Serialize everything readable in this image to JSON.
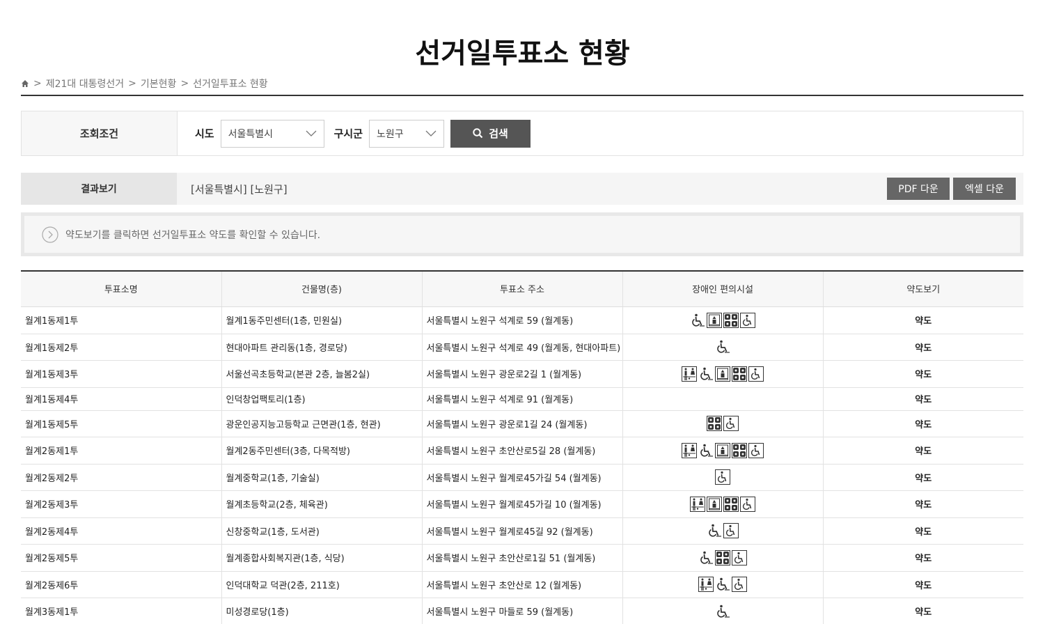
{
  "page": {
    "title": "선거일투표소 현황"
  },
  "breadcrumb": {
    "items": [
      "제21대 대통령선거",
      "기본현황",
      "선거일투표소 현황"
    ]
  },
  "search": {
    "label": "조회조건",
    "sido_label": "시도",
    "sido_value": "서울특별시",
    "gusigun_label": "구시군",
    "gusigun_value": "노원구",
    "button_label": "검색"
  },
  "result": {
    "label": "결과보기",
    "text": "[서울특별시] [노원구]",
    "pdf_label": "PDF 다운",
    "excel_label": "엑셀 다운"
  },
  "notice": {
    "text": "약도보기를 클릭하면 선거일투표소 약도를 확인할 수 있습니다."
  },
  "table": {
    "headers": [
      "투표소명",
      "건물명(층)",
      "투표소 주소",
      "장애인 편의시설",
      "약도보기"
    ],
    "rows": [
      {
        "name": "월계1동제1투",
        "building": "월계1동주민센터(1층, 민원실)",
        "address": "서울특별시 노원구 석계로 59 (월계동)",
        "icons": [
          "wheelchair-icon",
          "elevator-icon",
          "braille-icon",
          "accessible-toilet-icon"
        ],
        "map": "약도",
        "h": 39
      },
      {
        "name": "월계1동제2투",
        "building": "현대아파트 관리동(1층, 경로당)",
        "address": "서울특별시 노원구 석계로 49 (월계동, 현대아파트)",
        "icons": [
          "wheelchair-icon"
        ],
        "map": "약도",
        "h": 38
      },
      {
        "name": "월계1동제3투",
        "building": "서울선곡초등학교(본관 2층, 늘봄2실)",
        "address": "서울특별시 노원구 광운로2길 1 (월계동)",
        "icons": [
          "restroom-icon",
          "wheelchair-icon",
          "elevator-icon",
          "braille-icon",
          "accessible-toilet-icon"
        ],
        "map": "약도",
        "h": 39
      },
      {
        "name": "월계1동제4투",
        "building": "인덕창업팩토리(1층)",
        "address": "서울특별시 노원구 석계로 91 (월계동)",
        "icons": [],
        "map": "약도",
        "h": 33
      },
      {
        "name": "월계1동제5투",
        "building": "광운인공지능고등학교 근면관(1층, 현관)",
        "address": "서울특별시 노원구 광운로1길 24 (월계동)",
        "icons": [
          "braille-icon",
          "accessible-toilet-icon"
        ],
        "map": "약도",
        "h": 38
      },
      {
        "name": "월계2동제1투",
        "building": "월계2동주민센터(3층, 다목적방)",
        "address": "서울특별시 노원구 초안산로5길 28 (월계동)",
        "icons": [
          "restroom-icon",
          "wheelchair-icon",
          "elevator-icon",
          "braille-icon",
          "accessible-toilet-icon"
        ],
        "map": "약도",
        "h": 39
      },
      {
        "name": "월계2동제2투",
        "building": "월계중학교(1층, 기술실)",
        "address": "서울특별시 노원구 월계로45가길 54 (월계동)",
        "icons": [
          "accessible-toilet-icon"
        ],
        "map": "약도",
        "h": 38
      },
      {
        "name": "월계2동제3투",
        "building": "월계초등학교(2층, 체육관)",
        "address": "서울특별시 노원구 월계로45가길 10 (월계동)",
        "icons": [
          "restroom-icon",
          "elevator-icon",
          "braille-icon",
          "accessible-toilet-icon"
        ],
        "map": "약도",
        "h": 39
      },
      {
        "name": "월계2동제4투",
        "building": "신창중학교(1층, 도서관)",
        "address": "서울특별시 노원구 월계로45길 92 (월계동)",
        "icons": [
          "wheelchair-icon",
          "accessible-toilet-icon"
        ],
        "map": "약도",
        "h": 38
      },
      {
        "name": "월계2동제5투",
        "building": "월계종합사회복지관(1층, 식당)",
        "address": "서울특별시 노원구 초안산로1길 51 (월계동)",
        "icons": [
          "wheelchair-icon",
          "braille-icon",
          "accessible-toilet-icon"
        ],
        "map": "약도",
        "h": 39
      },
      {
        "name": "월계2동제6투",
        "building": "인덕대학교 덕관(2층, 211호)",
        "address": "서울특별시 노원구 초안산로 12 (월계동)",
        "icons": [
          "restroom-icon",
          "wheelchair-icon",
          "accessible-toilet-icon"
        ],
        "map": "약도",
        "h": 38
      },
      {
        "name": "월계3동제1투",
        "building": "미성경로당(1층)",
        "address": "서울특별시 노원구 마들로 59 (월계동)",
        "icons": [
          "wheelchair-icon"
        ],
        "map": "약도",
        "h": 39
      }
    ]
  }
}
